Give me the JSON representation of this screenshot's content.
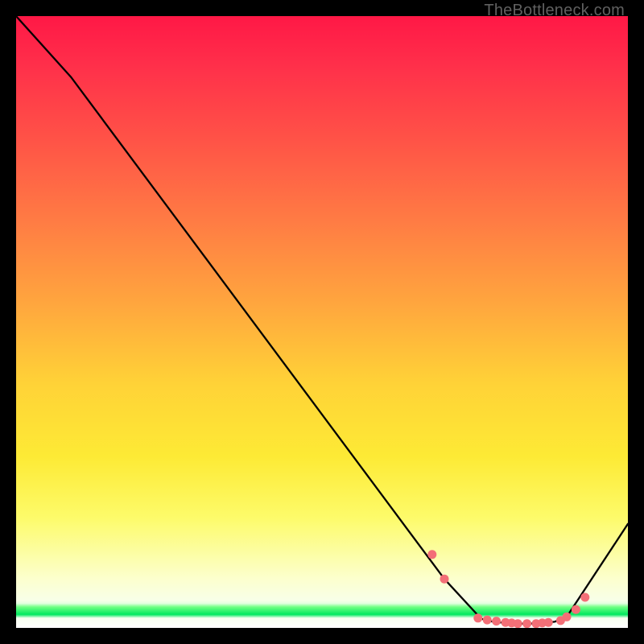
{
  "watermark": "TheBottleneck.com",
  "chart_data": {
    "type": "line",
    "title": "",
    "xlabel": "",
    "ylabel": "",
    "xlim": [
      0,
      100
    ],
    "ylim": [
      0,
      100
    ],
    "series": [
      {
        "name": "curve",
        "x": [
          0,
          9,
          70,
          76,
          78,
          80,
          82,
          84,
          86,
          88,
          90,
          100
        ],
        "y": [
          100,
          90,
          8,
          1.5,
          1,
          0.8,
          0.7,
          0.7,
          0.8,
          1,
          1.8,
          17
        ]
      }
    ],
    "markers": {
      "name": "highlight-points",
      "color": "#f36f77",
      "x": [
        68,
        70,
        75.5,
        77,
        78.5,
        80,
        81,
        82,
        83.5,
        85,
        86,
        87,
        89,
        90,
        91.5,
        93
      ],
      "y": [
        12,
        8,
        1.6,
        1.3,
        1.1,
        0.9,
        0.8,
        0.7,
        0.7,
        0.7,
        0.8,
        0.9,
        1.2,
        1.8,
        3,
        5
      ]
    }
  }
}
